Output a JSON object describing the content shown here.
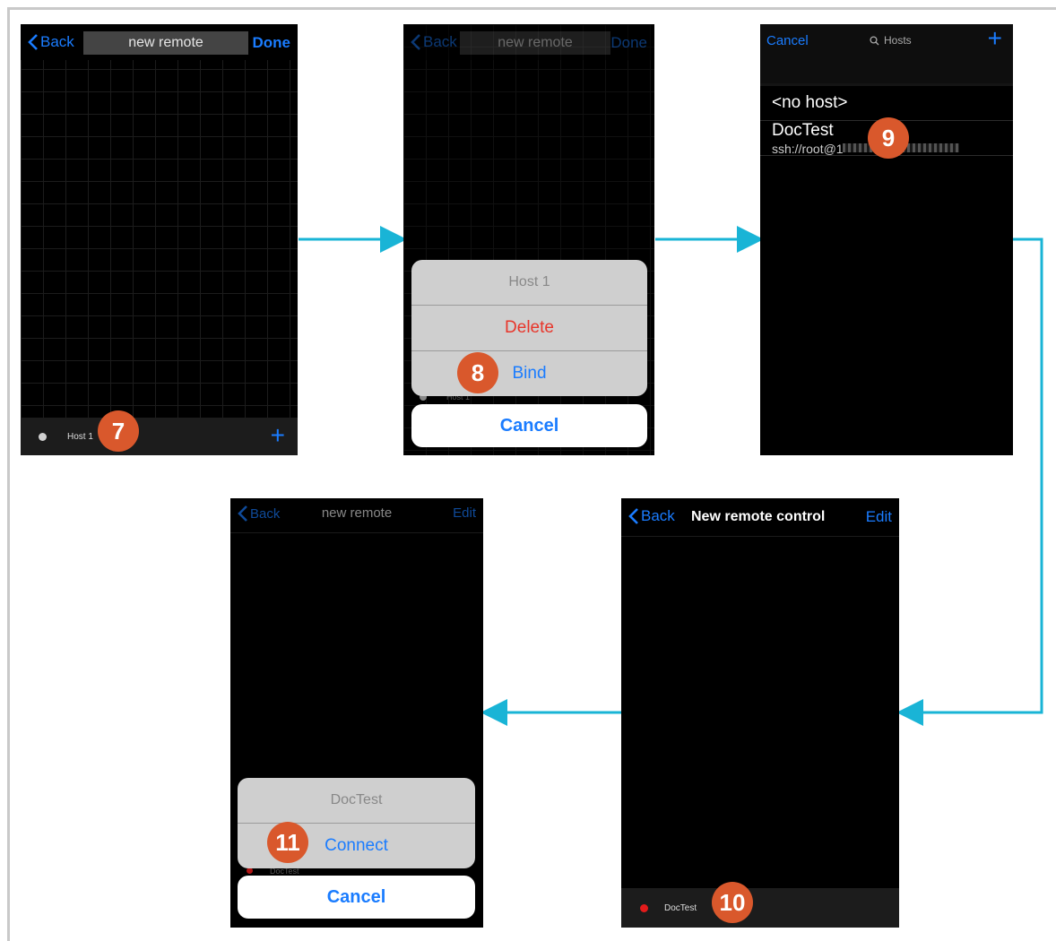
{
  "screen1": {
    "back": "Back",
    "title": "new remote",
    "done": "Done",
    "host_label": "Host 1",
    "plus": "+",
    "step": "7"
  },
  "screen2": {
    "back": "Back",
    "title": "new remote",
    "done": "Done",
    "sheet_title": "Host 1",
    "delete": "Delete",
    "bind": "Bind",
    "cancel": "Cancel",
    "bottom_label": "Host 1",
    "step": "8"
  },
  "screen3": {
    "cancel": "Cancel",
    "search_placeholder": "Hosts",
    "plus": "+",
    "no_host": "<no host>",
    "host_name": "DocTest",
    "host_url": "ssh://root@1",
    "step": "9"
  },
  "screen4": {
    "back": "Back",
    "title": "New remote control",
    "edit": "Edit",
    "host_label": "DocTest",
    "step": "10"
  },
  "screen5": {
    "back": "Back",
    "title": "new remote",
    "edit": "Edit",
    "sheet_title": "DocTest",
    "connect": "Connect",
    "cancel": "Cancel",
    "bottom_label": "DocTest",
    "step": "11"
  },
  "colors": {
    "ios_blue": "#1a7cff",
    "destructive_red": "#e8352a",
    "step_badge": "#d9582c",
    "flow_arrow": "#19b4d6",
    "status_red": "#e31b1b",
    "status_gray": "#d0d0d0"
  }
}
